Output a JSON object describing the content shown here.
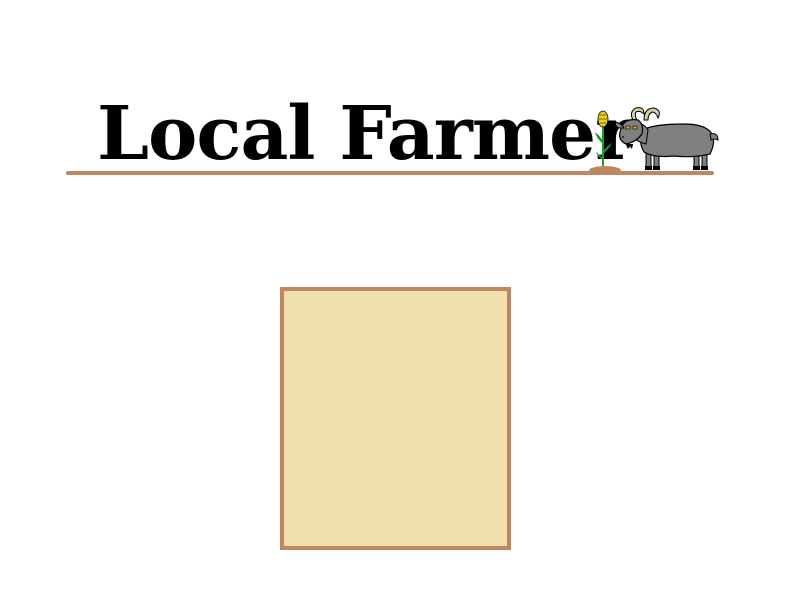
{
  "header": {
    "title": "Local Farmer"
  },
  "colors": {
    "title_text": "#000000",
    "ground": "#bf8660",
    "field_fill": "#eee1ac",
    "field_border": "#bf8660",
    "corn_kernel": "#e8d21c",
    "corn_stalk": "#1f9a30",
    "goat_body": "#808080",
    "goat_outline": "#000000",
    "goat_horn": "#d8cfa0",
    "goat_eye": "#e0a020"
  },
  "icons": {
    "corn": "corn-sprout-icon",
    "goat": "goat-icon"
  },
  "field": {
    "label": ""
  }
}
